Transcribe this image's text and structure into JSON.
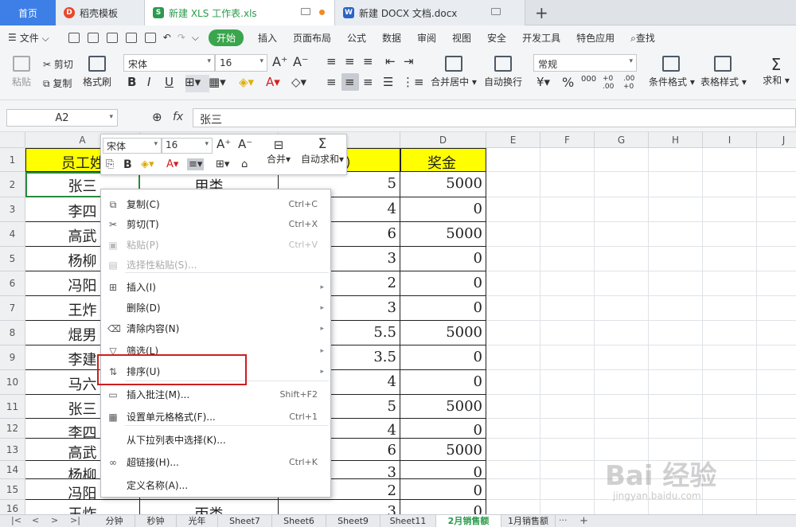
{
  "tabs": {
    "home": "首页",
    "t1": "稻壳模板",
    "t2": "新建 XLS 工作表.xls",
    "t3": "新建 DOCX 文档.docx",
    "new": "+"
  },
  "menu": {
    "file": "文件",
    "items": [
      "插入",
      "页面布局",
      "公式",
      "数据",
      "审阅",
      "视图",
      "安全",
      "开发工具",
      "特色应用"
    ],
    "start": "开始",
    "search": "查找"
  },
  "toolbar": {
    "paste": "粘贴",
    "cut": "剪切",
    "copy": "复制",
    "format_painter": "格式刷",
    "font": "宋体",
    "size": "16",
    "merge": "合并居中",
    "wrap": "自动换行",
    "numfmt": "常规",
    "cond": "条件格式",
    "table_style": "表格样式",
    "sum": "求和",
    "pct": "%",
    "thousand": "000",
    "dec_inc": "+0 .00",
    "dec_dec": ".00 +0"
  },
  "formula": {
    "cell": "A2",
    "fx": "fx",
    "value": "张三"
  },
  "columns": [
    "A",
    "B",
    "C",
    "D",
    "E",
    "F",
    "G",
    "H",
    "I",
    "J"
  ],
  "rows": [
    "1",
    "2",
    "3",
    "4",
    "5",
    "6",
    "7",
    "8",
    "9",
    "10",
    "11",
    "12",
    "13",
    "14",
    "15",
    "16"
  ],
  "cells": {
    "a": [
      "员工姓",
      "张三",
      "李四",
      "高武",
      "杨柳",
      "冯阳",
      "王炸",
      "焜男",
      "李建",
      "马六",
      "张三",
      "李四",
      "高武",
      "杨柳",
      "冯阳",
      "王炸"
    ],
    "b": [
      "",
      "甲类",
      "",
      "",
      "",
      "",
      "",
      "",
      "",
      "",
      "",
      "",
      "",
      "",
      "",
      "丙类"
    ],
    "c": [
      "（万）",
      "5",
      "4",
      "6",
      "3",
      "2",
      "3",
      "5.5",
      "3.5",
      "4",
      "5",
      "4",
      "6",
      "3",
      "2",
      "3"
    ],
    "d": [
      "奖金",
      "5000",
      "0",
      "5000",
      "0",
      "0",
      "0",
      "5000",
      "0",
      "0",
      "5000",
      "0",
      "5000",
      "0",
      "0",
      "0"
    ]
  },
  "mini_toolbar": {
    "font": "宋体",
    "size": "16",
    "merge": "合并",
    "autosum": "自动求和",
    "bold": "B"
  },
  "context_menu": [
    {
      "label": "复制(C)",
      "shortcut": "Ctrl+C",
      "icon": "copy-icon",
      "disabled": false,
      "sub": false
    },
    {
      "label": "剪切(T)",
      "shortcut": "Ctrl+X",
      "icon": "scissors-icon",
      "disabled": false,
      "sub": false
    },
    {
      "label": "粘贴(P)",
      "shortcut": "Ctrl+V",
      "icon": "paste-icon",
      "disabled": true,
      "sub": false
    },
    {
      "label": "选择性粘贴(S)...",
      "shortcut": "",
      "icon": "paste-special-icon",
      "disabled": true,
      "sub": false
    },
    {
      "label": "插入(I)",
      "shortcut": "",
      "icon": "insert-icon",
      "disabled": false,
      "sub": true
    },
    {
      "label": "删除(D)",
      "shortcut": "",
      "icon": "",
      "disabled": false,
      "sub": true
    },
    {
      "label": "清除内容(N)",
      "shortcut": "",
      "icon": "eraser-icon",
      "disabled": false,
      "sub": true
    },
    {
      "label": "筛选(L)",
      "shortcut": "",
      "icon": "filter-icon",
      "disabled": false,
      "sub": true
    },
    {
      "label": "排序(U)",
      "shortcut": "",
      "icon": "sort-icon",
      "disabled": false,
      "sub": true
    },
    {
      "label": "插入批注(M)...",
      "shortcut": "Shift+F2",
      "icon": "comment-icon",
      "disabled": false,
      "sub": false
    },
    {
      "label": "设置单元格格式(F)...",
      "shortcut": "Ctrl+1",
      "icon": "format-cells-icon",
      "disabled": false,
      "sub": false
    },
    {
      "label": "从下拉列表中选择(K)...",
      "shortcut": "",
      "icon": "",
      "disabled": false,
      "sub": false
    },
    {
      "label": "超链接(H)...",
      "shortcut": "Ctrl+K",
      "icon": "link-icon",
      "disabled": false,
      "sub": false
    },
    {
      "label": "定义名称(A)...",
      "shortcut": "",
      "icon": "",
      "disabled": false,
      "sub": false
    }
  ],
  "sheets": [
    "分钟",
    "秒钟",
    "光年",
    "Sheet7",
    "Sheet6",
    "Sheet9",
    "Sheet11",
    "2月销售额",
    "1月销售额"
  ],
  "active_sheet": "2月销售额",
  "sheet_more": "···",
  "watermark": {
    "brand": "Bai 经验",
    "url": "jingyan.baidu.com"
  },
  "colors": {
    "accent": "#3aa54d",
    "header_fill": "#ffff00",
    "highlight": "#cc1f1f"
  }
}
